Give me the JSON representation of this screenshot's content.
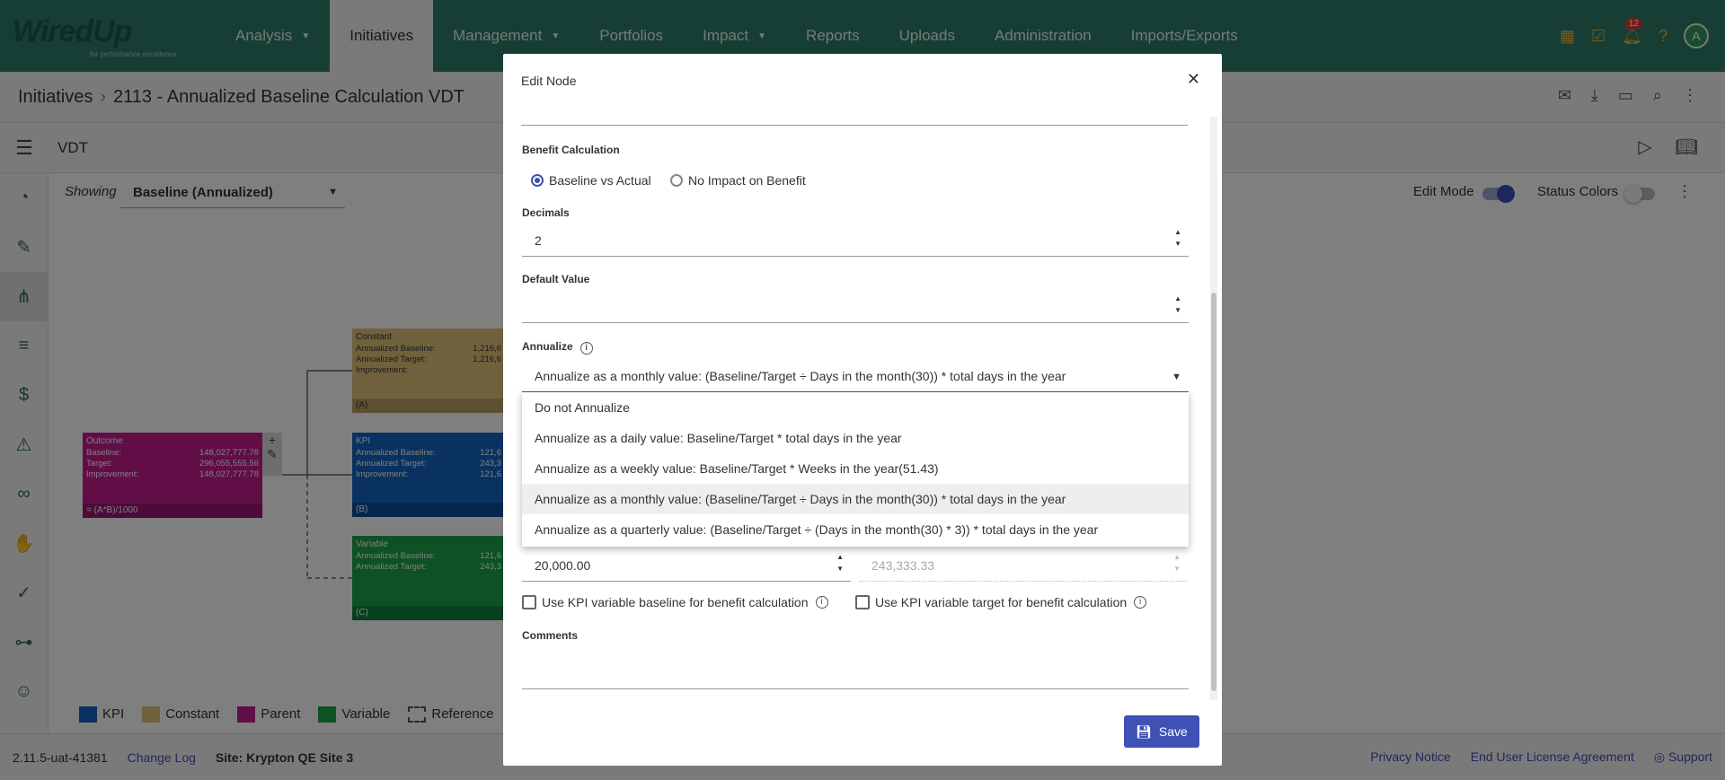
{
  "app": {
    "brand": "WiredUp",
    "tagline": "for performance excellence",
    "notifications": "12",
    "avatar": "A"
  },
  "nav": {
    "items": [
      "Analysis",
      "Initiatives",
      "Management",
      "Portfolios",
      "Impact",
      "Reports",
      "Uploads",
      "Administration",
      "Imports/Exports"
    ]
  },
  "breadcrumb": {
    "root": "Initiatives",
    "current": "2113 - Annualized Baseline Calculation VDT"
  },
  "subheader": {
    "title": "VDT"
  },
  "canvas": {
    "showing_label": "Showing",
    "showing_value": "Baseline (Annualized)",
    "edit_mode": "Edit Mode",
    "status_colors": "Status Colors",
    "nodes": {
      "outcome": {
        "title": "Outcome",
        "rows": [
          [
            "Baseline:",
            "148,027,777.78"
          ],
          [
            "Target:",
            "296,055,555.56"
          ],
          [
            "Improvement:",
            "148,027,777.78"
          ]
        ],
        "formula": "= (A*B)/1000"
      },
      "constant": {
        "title": "Constant",
        "rows": [
          [
            "Annualized Baseline:",
            "1,216,6"
          ],
          [
            "Annualized Target:",
            "1,216,6"
          ],
          [
            "Improvement:",
            ""
          ]
        ],
        "ref": "(A)"
      },
      "kpi": {
        "title": "KPI",
        "rows": [
          [
            "Annualized Baseline:",
            "121,6"
          ],
          [
            "Annualized Target:",
            "243,3"
          ],
          [
            "Improvement:",
            "121,6"
          ]
        ],
        "ref": "(B)"
      },
      "variable": {
        "title": "Variable",
        "rows": [
          [
            "Annualized Baseline:",
            "121,6"
          ],
          [
            "Annualized Target:",
            "243,3"
          ]
        ],
        "ref": "(C)"
      }
    },
    "legend": [
      "KPI",
      "Constant",
      "Parent",
      "Variable",
      "Reference"
    ]
  },
  "footer": {
    "version": "2.11.5-uat-41381",
    "changelog": "Change Log",
    "site": "Site: Krypton QE Site 3",
    "privacy": "Privacy Notice",
    "eula": "End User License Agreement",
    "support": "Support"
  },
  "modal": {
    "title": "Edit Node",
    "benefit_label": "Benefit Calculation",
    "radio_baseline": "Baseline vs Actual",
    "radio_noimpact": "No Impact on Benefit",
    "decimals_label": "Decimals",
    "decimals_value": "2",
    "default_label": "Default Value",
    "default_value": "",
    "annualize_label": "Annualize",
    "annualize_selected": "Annualize as a monthly value: (Baseline/Target ÷ Days in the month(30)) * total days in the year",
    "annualize_options": [
      "Do not Annualize",
      "Annualize as a daily value: Baseline/Target * total days in the year",
      "Annualize as a weekly value: Baseline/Target * Weeks in the year(51.43)",
      "Annualize as a monthly value: (Baseline/Target ÷ Days in the month(30)) * total days in the year",
      "Annualize as a quarterly value: (Baseline/Target ÷ (Days in the month(30) * 3)) * total days in the year"
    ],
    "target_value": "20,000.00",
    "annualized_target_value": "243,333.33",
    "chk_baseline": "Use KPI variable baseline for benefit calculation",
    "chk_target": "Use KPI variable target for benefit calculation",
    "comments_label": "Comments",
    "save": "Save"
  }
}
